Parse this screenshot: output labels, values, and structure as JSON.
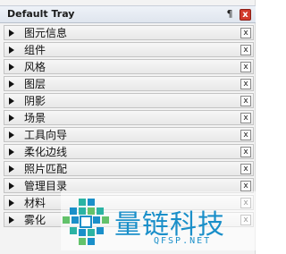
{
  "tray": {
    "title": "Default Tray",
    "pin_glyph": "¶",
    "close_glyph": "x"
  },
  "panels": [
    {
      "label": "图元信息",
      "close_glyph": "x"
    },
    {
      "label": "组件",
      "close_glyph": "x"
    },
    {
      "label": "风格",
      "close_glyph": "x"
    },
    {
      "label": "图层",
      "close_glyph": "x"
    },
    {
      "label": "阴影",
      "close_glyph": "x"
    },
    {
      "label": "场景",
      "close_glyph": "x"
    },
    {
      "label": "工具向导",
      "close_glyph": "x"
    },
    {
      "label": "柔化边线",
      "close_glyph": "x"
    },
    {
      "label": "照片匹配",
      "close_glyph": "x"
    },
    {
      "label": "管理目录",
      "close_glyph": "x"
    },
    {
      "label": "材料",
      "close_glyph": "x"
    },
    {
      "label": "雾化",
      "close_glyph": "x"
    }
  ],
  "watermark": {
    "text": "量链科技",
    "sub": "QFSP.NET",
    "color": "#1a8fc9",
    "icon": "cross-logo-icon"
  }
}
